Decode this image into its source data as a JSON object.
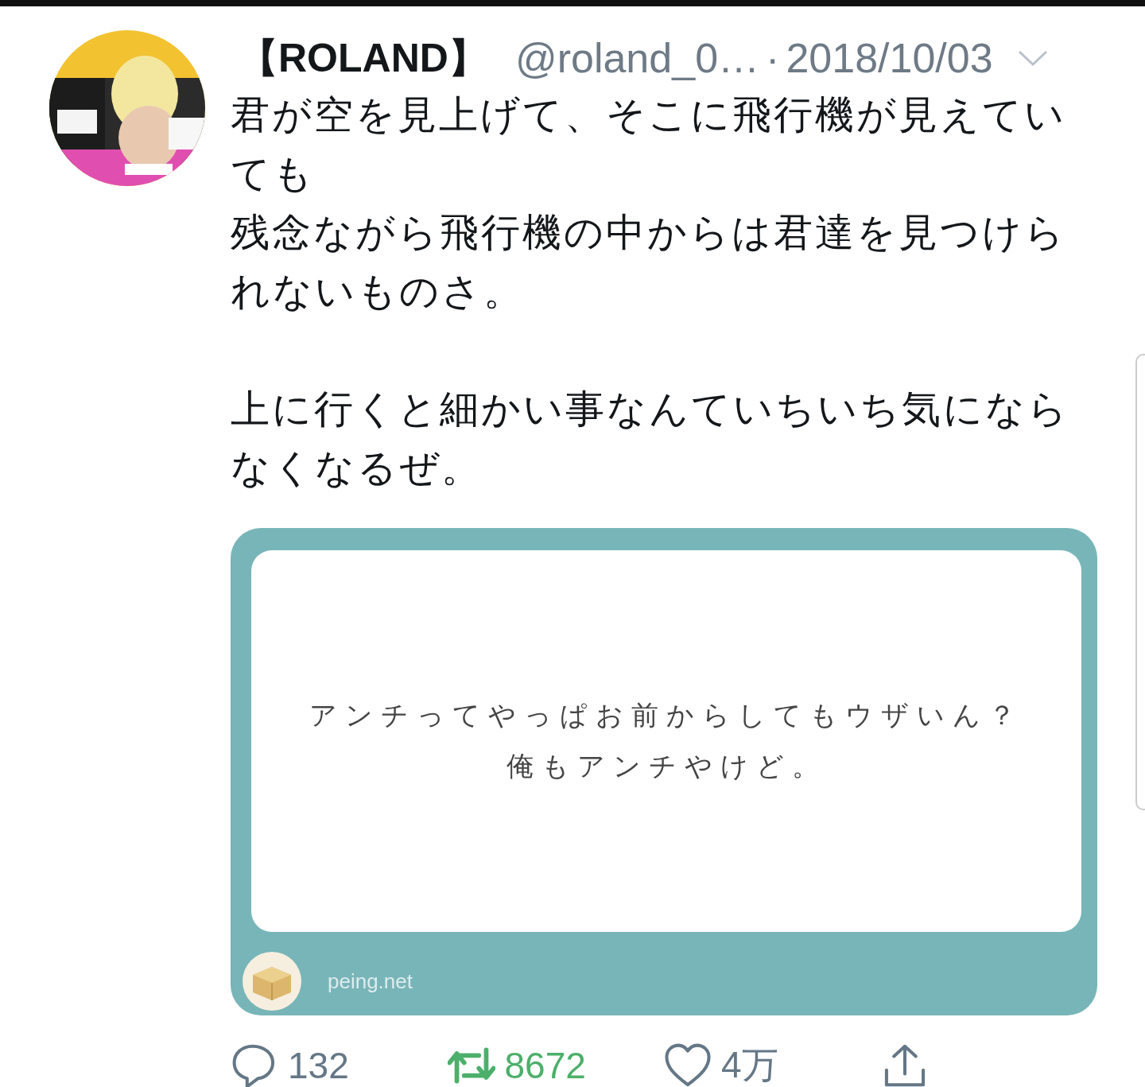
{
  "tweet": {
    "author": {
      "name": "【ROLAND】",
      "handle": "@roland_0…",
      "separator": "·",
      "date": "2018/10/03"
    },
    "paragraphs": [
      {
        "lines": [
          "君が空を見上げて、そこに飛行機が見えていても",
          "残念ながら飛行機の中からは君達を見つけられないものさ。"
        ]
      },
      {
        "lines": [
          "上に行くと細かい事なんていちいち気にならなくなるぜ。"
        ]
      }
    ],
    "card": {
      "question_lines": [
        "アンチってやっぱお前からしてもウザいん？",
        "俺もアンチやけど。"
      ],
      "site": "peing.net"
    },
    "actions": [
      {
        "kind": "reply",
        "count": "132",
        "active": false
      },
      {
        "kind": "retweet",
        "count": "8672",
        "active": true
      },
      {
        "kind": "like",
        "count": "4万",
        "active": false
      },
      {
        "kind": "share",
        "active": false
      }
    ]
  }
}
